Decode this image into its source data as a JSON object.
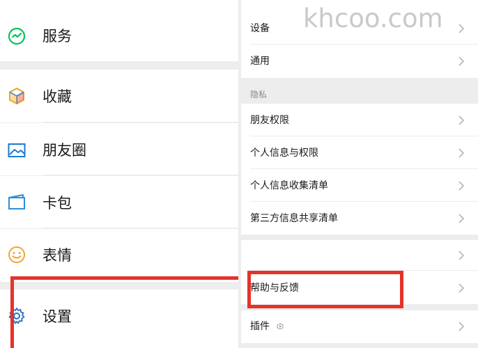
{
  "left_menu": {
    "items": [
      {
        "label": "服务",
        "icon": "service-icon"
      },
      {
        "label": "收藏",
        "icon": "favorites-cube-icon"
      },
      {
        "label": "朋友圈",
        "icon": "moments-picture-icon"
      },
      {
        "label": "卡包",
        "icon": "card-wallet-icon"
      },
      {
        "label": "表情",
        "icon": "smiley-icon"
      },
      {
        "label": "设置",
        "icon": "gear-icon"
      }
    ]
  },
  "right_settings": {
    "top_items": [
      {
        "label": "设备"
      },
      {
        "label": "通用"
      }
    ],
    "privacy_header": "隐私",
    "privacy_items": [
      {
        "label": "朋友权限"
      },
      {
        "label": "个人信息与权限"
      },
      {
        "label": "个人信息收集清单"
      },
      {
        "label": "第三方信息共享清单"
      }
    ],
    "bottom_items": [
      {
        "label": ""
      },
      {
        "label": "帮助与反馈"
      },
      {
        "label": "插件"
      }
    ]
  },
  "watermark": "khcoo.com",
  "colors": {
    "highlight": "#e5332a",
    "background": "#ededed",
    "service_icon": "#07c160",
    "favorites_icon": "#f5a623",
    "moments_icon": "#1a7ad4",
    "card_icon": "#2a8fd6",
    "smiley_icon": "#f0a531",
    "gear_icon": "#2a6fc0"
  }
}
